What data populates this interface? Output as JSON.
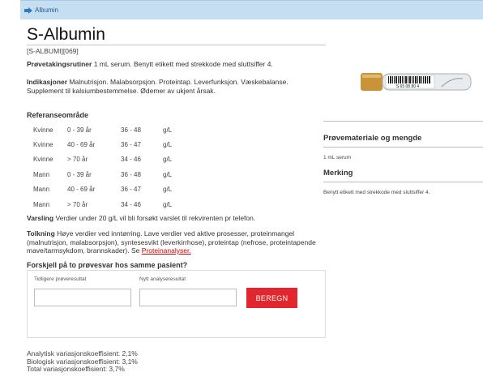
{
  "tab": {
    "label": "Albumin"
  },
  "title": "S-Albumin",
  "code": "[S-ALBUMI][069]",
  "sampling": {
    "label": "Prøvetakingsrutiner",
    "text": "1 mL serum. Benytt etikett med strekkode med sluttsiffer 4."
  },
  "indications": {
    "label": "Indikasjoner",
    "text": "Malnutrisjon. Malabsorpsjon. Proteintap. Leverfunksjon. Væskebalanse. Supplement til kalsiumbestemmelse. Ødemer av ukjent årsak."
  },
  "reference": {
    "title": "Referanseområde",
    "rows": [
      {
        "sex": "Kvinne",
        "age": "0 - 39 år",
        "range": "36 - 48",
        "unit": "g/L"
      },
      {
        "sex": "Kvinne",
        "age": "40 - 69 år",
        "range": "36 - 47",
        "unit": "g/L"
      },
      {
        "sex": "Kvinne",
        "age": "> 70 år",
        "range": "34 - 46",
        "unit": "g/L"
      },
      {
        "sex": "Mann",
        "age": "0 - 39 år",
        "range": "36 - 48",
        "unit": "g/L"
      },
      {
        "sex": "Mann",
        "age": "40 - 69 år",
        "range": "36 - 47",
        "unit": "g/L"
      },
      {
        "sex": "Mann",
        "age": "> 70 år",
        "range": "34 - 46",
        "unit": "g/L"
      }
    ]
  },
  "alert": {
    "label": "Varsling",
    "text": "Verdier under 20 g/L vil bli forsøkt varslet til rekvirenten pr telefon."
  },
  "interpretation": {
    "label": "Tolkning",
    "text": "Høye verdier ved inntørring. Lave verdier ved aktive prosesser, proteinmangel (malnutrisjon, malabsorpsjon), syntesesvikt (leverkirrhose), proteintap (nefrose, proteintapende mave/tarmsykdom, brannskader). Se",
    "link": "Proteinanalyser."
  },
  "calculator": {
    "title": "Forskjell på to prøvesvar hos samme pasient?",
    "previous_label": "Tidligere prøveresultat",
    "previous_value": "",
    "new_label": "Nytt analyseresultat",
    "new_value": "",
    "button": "BEREGN"
  },
  "variance": {
    "analytic": "Analytisk variasjonskoeffisient: 2,1%",
    "biologic": "Biologisk variasjonskoeffisient: 3,1%",
    "total": "Total variasjonskoeffisient: 3,7%"
  },
  "sidebar": {
    "tube_label": "S 65 08 80 4",
    "material_title": "Prøvemateriale og mengde",
    "material_text": "1 mL serum",
    "marking_title": "Merking",
    "marking_text": "Benytt etikett med strekkode med sluttsiffer 4."
  },
  "colors": {
    "tab_bg": "#c6def1",
    "button": "#e1262d",
    "link": "#cc0000",
    "tube_cap": "#c9933a"
  }
}
